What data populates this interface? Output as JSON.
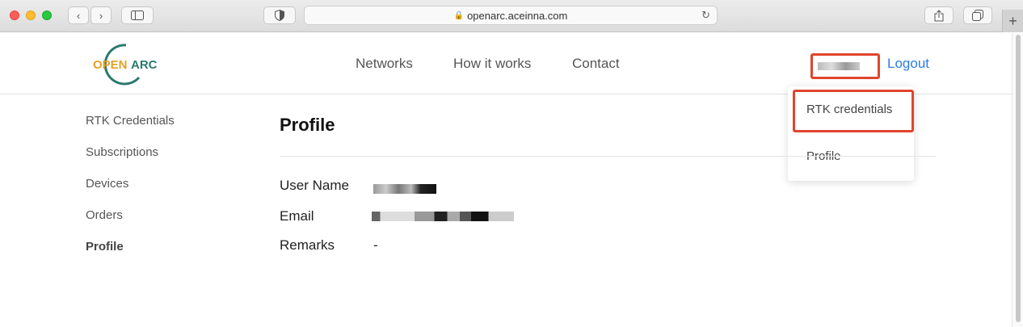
{
  "browser": {
    "url": "openarc.aceinna.com"
  },
  "brand": {
    "logo_text_open": "OPEN",
    "logo_text_arc": "ARC",
    "accent_orange": "#e3a128",
    "accent_teal": "#2b7a6e"
  },
  "nav": {
    "items": [
      "Networks",
      "How it works",
      "Contact"
    ],
    "logout": "Logout"
  },
  "dropdown": {
    "items": [
      "RTK credentials",
      "Profile"
    ]
  },
  "sidebar": {
    "items": [
      "RTK Credentials",
      "Subscriptions",
      "Devices",
      "Orders",
      "Profile"
    ],
    "active": "Profile"
  },
  "profile": {
    "title": "Profile",
    "fields": [
      {
        "label": "User Name",
        "value": ""
      },
      {
        "label": "Email",
        "value": ""
      },
      {
        "label": "Remarks",
        "value": "-"
      }
    ]
  },
  "colors": {
    "highlight_border": "#e0452c",
    "link": "#2b7de9"
  }
}
